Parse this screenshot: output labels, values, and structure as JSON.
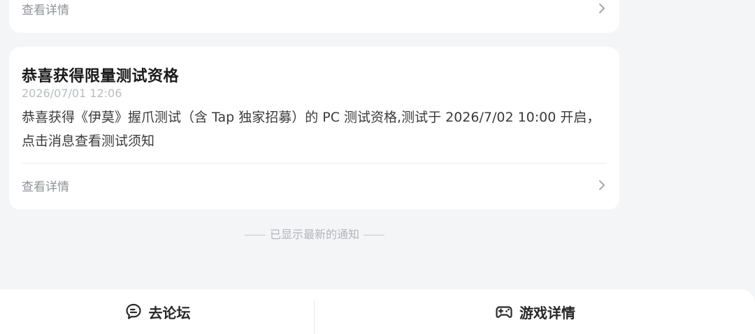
{
  "cards": [
    {
      "detail_label": "查看详情"
    },
    {
      "title": "恭喜获得限量测试资格",
      "time": "2026/07/01 12:06",
      "body": "恭喜获得《伊莫》握爪测试（含 Tap 独家招募）的 PC 测试资格,测试于 2026/7/02 10:00 开启，点击消息查看测试须知",
      "detail_label": "查看详情"
    }
  ],
  "footer_note": "已显示最新的通知",
  "bottom_bar": {
    "forum_label": "去论坛",
    "forum_icon": "chat-bubble-icon",
    "game_label": "游戏详情",
    "game_icon": "gamepad-icon"
  },
  "colors": {
    "background": "#f4f5f7",
    "card": "#ffffff",
    "muted_text": "#8f9297"
  }
}
